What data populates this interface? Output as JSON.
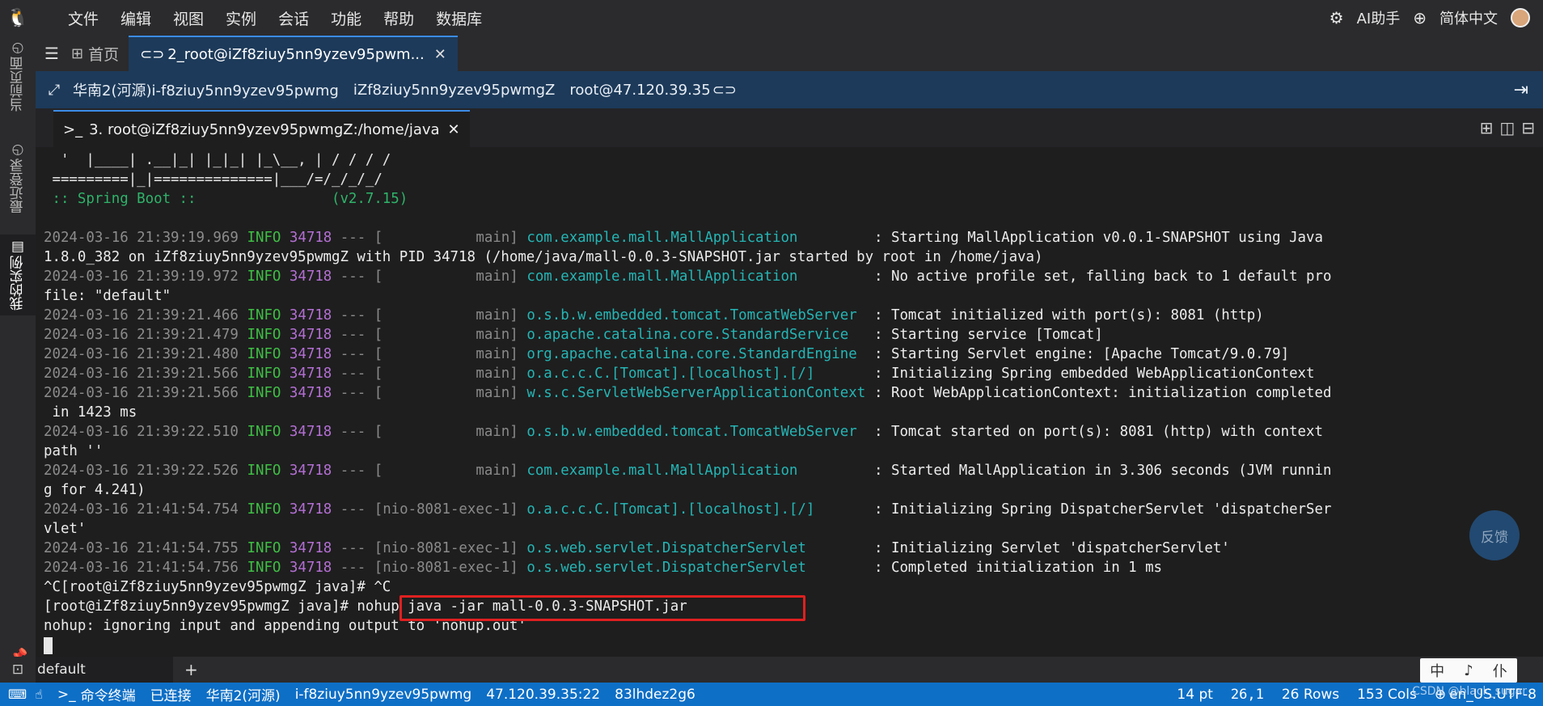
{
  "menubar": {
    "items": [
      "文件",
      "编辑",
      "视图",
      "实例",
      "会话",
      "功能",
      "帮助",
      "数据库"
    ],
    "ai_assistant": "AI助手",
    "language": "简体中文"
  },
  "sidebar": {
    "tabs": [
      "当前页面",
      "最近登录",
      "我的实例"
    ],
    "active": "我的实例"
  },
  "tabs": {
    "home": "首页",
    "session": "2_root@iZf8ziuy5nn9yzev95pwm..."
  },
  "infobar": {
    "region_instance": "华南2(河源)i-f8ziuy5nn9yzev95pwmg",
    "hostname": "iZf8ziuy5nn9yzev95pwmgZ",
    "login": "root@47.120.39.35"
  },
  "terminal_tab": {
    "label": "3. root@iZf8ziuy5nn9yzev95pwmgZ:/home/java"
  },
  "banner": [
    "  '  |____| .__|_| |_|_| |_\\__, | / / / /",
    " =========|_|==============|___/=/_/_/_/",
    " :: Spring Boot ::                (v2.7.15)"
  ],
  "log": [
    {
      "ts": "2024-03-16 21:39:19.969",
      "lvl": "INFO",
      "pid": "34718",
      "sep": "---",
      "thread": "[           main]",
      "logger": "com.example.mall.MallApplication",
      "msg": ": Starting MallApplication v0.0.1-SNAPSHOT using Java",
      "cont": "1.8.0_382 on iZf8ziuy5nn9yzev95pwmgZ with PID 34718 (/home/java/mall-0.0.3-SNAPSHOT.jar started by root in /home/java)"
    },
    {
      "ts": "2024-03-16 21:39:19.972",
      "lvl": "INFO",
      "pid": "34718",
      "sep": "---",
      "thread": "[           main]",
      "logger": "com.example.mall.MallApplication",
      "msg": ": No active profile set, falling back to 1 default pro",
      "cont": "file: \"default\""
    },
    {
      "ts": "2024-03-16 21:39:21.466",
      "lvl": "INFO",
      "pid": "34718",
      "sep": "---",
      "thread": "[           main]",
      "logger": "o.s.b.w.embedded.tomcat.TomcatWebServer",
      "msg": ": Tomcat initialized with port(s): 8081 (http)",
      "cont": ""
    },
    {
      "ts": "2024-03-16 21:39:21.479",
      "lvl": "INFO",
      "pid": "34718",
      "sep": "---",
      "thread": "[           main]",
      "logger": "o.apache.catalina.core.StandardService",
      "msg": ": Starting service [Tomcat]",
      "cont": ""
    },
    {
      "ts": "2024-03-16 21:39:21.480",
      "lvl": "INFO",
      "pid": "34718",
      "sep": "---",
      "thread": "[           main]",
      "logger": "org.apache.catalina.core.StandardEngine",
      "msg": ": Starting Servlet engine: [Apache Tomcat/9.0.79]",
      "cont": ""
    },
    {
      "ts": "2024-03-16 21:39:21.566",
      "lvl": "INFO",
      "pid": "34718",
      "sep": "---",
      "thread": "[           main]",
      "logger": "o.a.c.c.C.[Tomcat].[localhost].[/]",
      "msg": ": Initializing Spring embedded WebApplicationContext",
      "cont": ""
    },
    {
      "ts": "2024-03-16 21:39:21.566",
      "lvl": "INFO",
      "pid": "34718",
      "sep": "---",
      "thread": "[           main]",
      "logger": "w.s.c.ServletWebServerApplicationContext",
      "msg": ": Root WebApplicationContext: initialization completed",
      "cont": " in 1423 ms"
    },
    {
      "ts": "2024-03-16 21:39:22.510",
      "lvl": "INFO",
      "pid": "34718",
      "sep": "---",
      "thread": "[           main]",
      "logger": "o.s.b.w.embedded.tomcat.TomcatWebServer",
      "msg": ": Tomcat started on port(s): 8081 (http) with context",
      "cont": "path ''"
    },
    {
      "ts": "2024-03-16 21:39:22.526",
      "lvl": "INFO",
      "pid": "34718",
      "sep": "---",
      "thread": "[           main]",
      "logger": "com.example.mall.MallApplication",
      "msg": ": Started MallApplication in 3.306 seconds (JVM runnin",
      "cont": "g for 4.241)"
    },
    {
      "ts": "2024-03-16 21:41:54.754",
      "lvl": "INFO",
      "pid": "34718",
      "sep": "---",
      "thread": "[nio-8081-exec-1]",
      "logger": "o.a.c.c.C.[Tomcat].[localhost].[/]",
      "msg": ": Initializing Spring DispatcherServlet 'dispatcherSer",
      "cont": "vlet'"
    },
    {
      "ts": "2024-03-16 21:41:54.755",
      "lvl": "INFO",
      "pid": "34718",
      "sep": "---",
      "thread": "[nio-8081-exec-1]",
      "logger": "o.s.web.servlet.DispatcherServlet",
      "msg": ": Initializing Servlet 'dispatcherServlet'",
      "cont": ""
    },
    {
      "ts": "2024-03-16 21:41:54.756",
      "lvl": "INFO",
      "pid": "34718",
      "sep": "---",
      "thread": "[nio-8081-exec-1]",
      "logger": "o.s.web.servlet.DispatcherServlet",
      "msg": ": Completed initialization in 1 ms",
      "cont": ""
    }
  ],
  "prompt_lines": {
    "interrupt": "^C[root@iZf8ziuy5nn9yzev95pwmgZ java]# ^C",
    "prompt": "[root@iZf8ziuy5nn9yzev95pwmgZ java]#",
    "command": " nohup java -jar mall-0.0.3-SNAPSHOT.jar",
    "output": "nohup: ignoring input and appending output to 'nohup.out'"
  },
  "feedback": "反馈",
  "panel": {
    "tab": "default",
    "ime": [
      "中",
      "♪",
      "仆"
    ]
  },
  "statusbar": {
    "terminal": "命令终端",
    "state": "已连接",
    "region": "华南2(河源)",
    "instance": "i-f8ziuy5nn9yzev95pwmg",
    "endpoint": "47.120.39.35:22",
    "code": "83lhdez2g6",
    "font_size": "14 pt",
    "cursor_pos": "26,1",
    "rows": "26 Rows",
    "cols": "153 Cols",
    "locale": "en_US.UTF-8",
    "watermark": "CSDN @black_sugar"
  }
}
